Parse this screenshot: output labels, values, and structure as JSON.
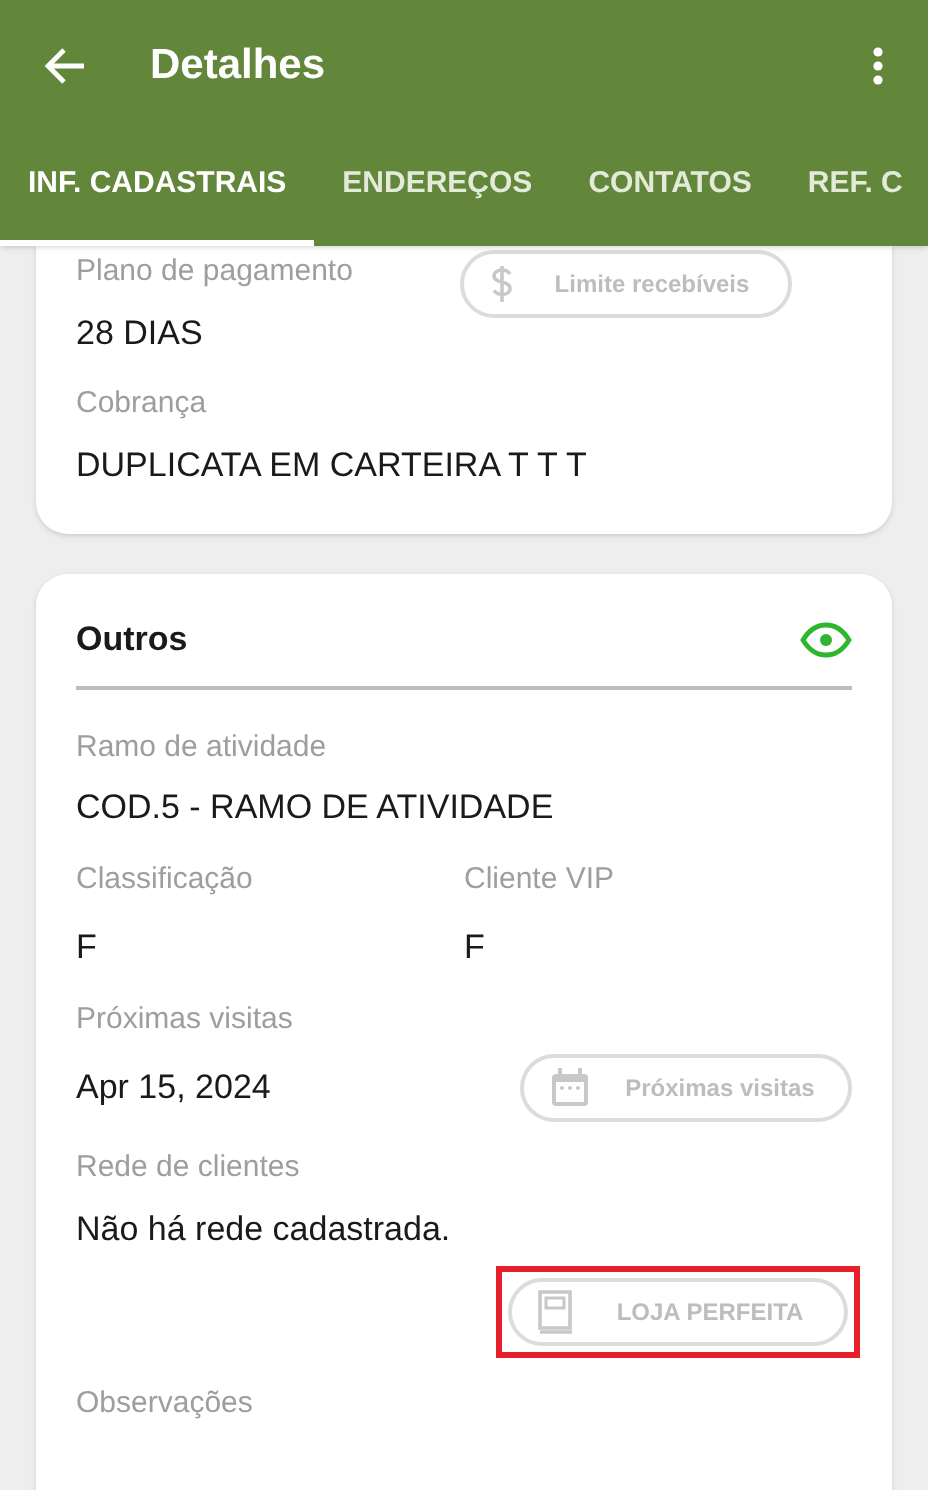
{
  "app_bar": {
    "title": "Detalhes"
  },
  "tabs": [
    {
      "label": "INF. CADASTRAIS",
      "selected": true
    },
    {
      "label": "ENDEREÇOS",
      "selected": false
    },
    {
      "label": "CONTATOS",
      "selected": false
    },
    {
      "label": "REF. C",
      "selected": false
    }
  ],
  "payment_card": {
    "fields": [
      {
        "label": "Plano de pagamento",
        "value": "28 DIAS",
        "button": {
          "label": "Limite recebíveis",
          "kind": "dollar",
          "disabled": true,
          "highlighted": false
        }
      },
      {
        "label": "Cobrança",
        "value": "DUPLICATA EM CARTEIRA T T T"
      }
    ]
  },
  "others_card": {
    "title": "Outros",
    "visible": true,
    "fields": [
      {
        "label": "Ramo de atividade",
        "value": "COD.5 - RAMO DE ATIVIDADE"
      },
      {
        "kind": "pair",
        "items": [
          {
            "label": "Classificação",
            "value": "F"
          },
          {
            "label": "Cliente VIP",
            "value": "F"
          }
        ]
      },
      {
        "label": "Próximas visitas",
        "value": "Apr 15, 2024",
        "button": {
          "label": "Próximas visitas",
          "kind": "calendar",
          "disabled": true,
          "highlighted": false
        }
      },
      {
        "label": "Rede de clientes",
        "value": "Não há rede cadastrada.",
        "button": {
          "label": "LOJA PERFEITA",
          "kind": "book",
          "disabled": true,
          "highlighted": true
        },
        "button_below": true
      },
      {
        "label": "Observações"
      }
    ]
  }
}
